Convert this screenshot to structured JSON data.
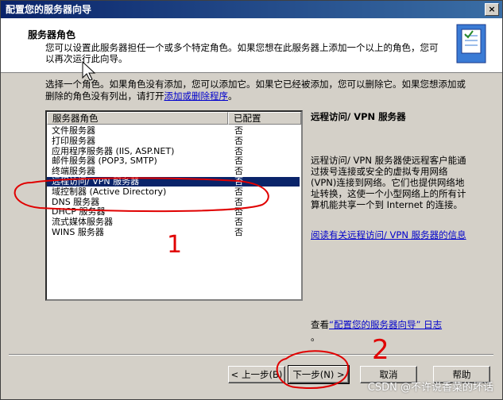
{
  "window": {
    "title": "配置您的服务器向导",
    "close_glyph": "×"
  },
  "header": {
    "title": "服务器角色",
    "description": "您可以设置此服务器担任一个或多个特定角色。如果您想在此服务器上添加一个以上的角色，您可以再次运行此向导。"
  },
  "intro": {
    "text": "选择一个角色。如果角色没有添加，您可以添加它。如果它已经被添加，您可以删除它。如果您想添加或删除的角色没有列出，请打开",
    "link": "添加或删除程序",
    "suffix": "。"
  },
  "roles": {
    "headers": [
      "服务器角色",
      "已配置"
    ],
    "rows": [
      {
        "name": "文件服务器",
        "configured": "否"
      },
      {
        "name": "打印服务器",
        "configured": "否"
      },
      {
        "name": "应用程序服务器 (IIS, ASP.NET)",
        "configured": "否"
      },
      {
        "name": "邮件服务器 (POP3, SMTP)",
        "configured": "否"
      },
      {
        "name": "终端服务器",
        "configured": "否"
      },
      {
        "name": "远程访问/ VPN 服务器",
        "configured": "否"
      },
      {
        "name": "域控制器 (Active Directory)",
        "configured": "否"
      },
      {
        "name": "DNS 服务器",
        "configured": "否"
      },
      {
        "name": "DHCP 服务器",
        "configured": "否"
      },
      {
        "name": "流式媒体服务器",
        "configured": "否"
      },
      {
        "name": "WINS 服务器",
        "configured": "否"
      }
    ]
  },
  "details": {
    "title": "远程访问/ VPN 服务器",
    "description": "远程访问/ VPN 服务器使远程客户能通过拨号连接或安全的虚拟专用网络(VPN)连接到网络。它们也提供网络地址转换，这使一个小型网络上的所有计算机能共享一个到 Internet 的连接。",
    "link": "阅读有关远程访问/ VPN 服务器的信息"
  },
  "log": {
    "prefix": "查看",
    "link": "“配置您的服务器向导” 日志",
    "suffix": "。"
  },
  "buttons": {
    "back": "< 上一步(B)",
    "next": "下一步(N) >",
    "cancel": "取消",
    "help": "帮助"
  },
  "watermark": "CSDN @不许说香菜的坏话",
  "annotations": {
    "one": "1",
    "two": "2"
  },
  "colors": {
    "title_bar": "#0a246a",
    "selection": "#0a246a",
    "link": "#0000cc",
    "annotation": "#e00000"
  }
}
